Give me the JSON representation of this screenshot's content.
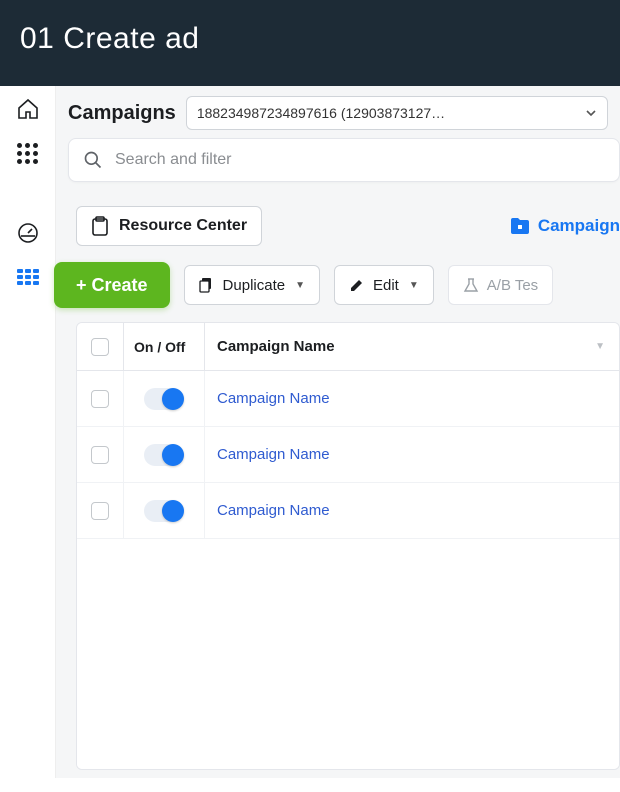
{
  "banner": {
    "title": "01 Create ad"
  },
  "header": {
    "title": "Campaigns",
    "account_label": "188234987234897616 (12903873127…"
  },
  "search": {
    "placeholder": "Search and filter"
  },
  "resource_center": {
    "label": "Resource Center"
  },
  "tabs": {
    "campaigns": "Campaign"
  },
  "toolbar": {
    "create": "+ Create",
    "duplicate": "Duplicate",
    "edit": "Edit",
    "ab_test": "A/B Tes"
  },
  "table": {
    "headers": {
      "onoff": "On / Off",
      "name": "Campaign Name"
    },
    "rows": [
      {
        "name": "Campaign Name",
        "on": true
      },
      {
        "name": "Campaign Name",
        "on": true
      },
      {
        "name": "Campaign Name",
        "on": true
      }
    ]
  }
}
